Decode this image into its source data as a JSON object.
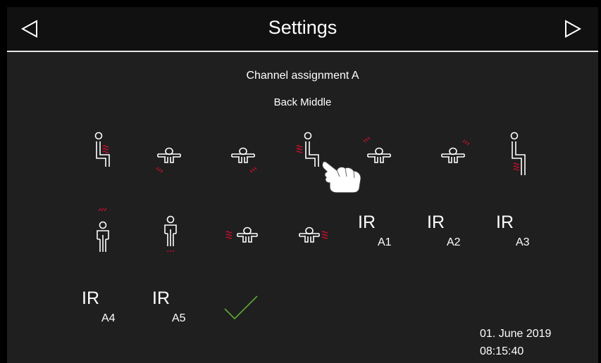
{
  "header": {
    "title": "Settings",
    "prev_icon": "triangle-left-icon",
    "next_icon": "triangle-right-icon"
  },
  "main": {
    "channel_title": "Channel assignment A",
    "zone_name": "Back Middle",
    "zones": [
      {
        "icon": "seat-side-back-heat-icon"
      },
      {
        "icon": "body-top-lower-left-heat-icon"
      },
      {
        "icon": "body-top-lower-right-heat-icon"
      },
      {
        "icon": "seat-side-back-middle-heat-icon",
        "selected": true
      },
      {
        "icon": "body-top-upper-left-heat-icon"
      },
      {
        "icon": "body-top-upper-right-heat-icon"
      },
      {
        "icon": "seat-side-calf-heat-icon"
      },
      {
        "icon": "body-front-head-heat-icon"
      },
      {
        "icon": "body-front-feet-heat-icon"
      },
      {
        "icon": "body-top-left-side-heat-icon"
      },
      {
        "icon": "body-top-right-side-heat-icon"
      }
    ],
    "ir_channels": [
      {
        "main": "IR",
        "sub": "A1"
      },
      {
        "main": "IR",
        "sub": "A2"
      },
      {
        "main": "IR",
        "sub": "A3"
      },
      {
        "main": "IR",
        "sub": "A4"
      },
      {
        "main": "IR",
        "sub": "A5"
      }
    ],
    "confirm_icon": "checkmark-icon"
  },
  "status": {
    "date": "01. June 2019",
    "time": "08:15:40"
  },
  "colors": {
    "background": "#1f1f1f",
    "header": "#111111",
    "heat": "#c8102e",
    "confirm": "#5fa83a",
    "line": "#ffffff"
  }
}
